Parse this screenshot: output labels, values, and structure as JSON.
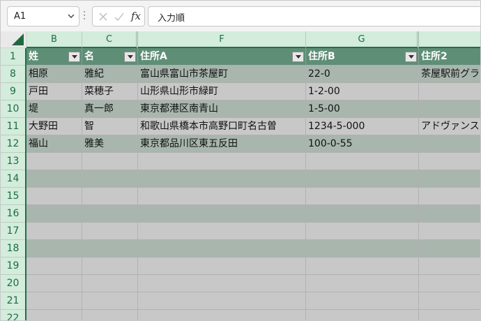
{
  "formula_bar": {
    "name_box": "A1",
    "formula_text": "入力順"
  },
  "columns": [
    "B",
    "C",
    "F",
    "G",
    ""
  ],
  "rows": [
    "1",
    "8",
    "9",
    "10",
    "11",
    "12",
    "13",
    "14",
    "15",
    "16",
    "17",
    "18",
    "19",
    "20",
    "21",
    "22"
  ],
  "table": {
    "headers": [
      "姓",
      "名",
      "住所A",
      "住所B",
      "住所2"
    ],
    "data": [
      [
        "相原",
        "雅紀",
        "富山県富山市茶屋町",
        "22-0",
        "茶屋駅前グラ"
      ],
      [
        "戸田",
        "菜穂子",
        "山形県山形市緑町",
        "1-2-00",
        ""
      ],
      [
        "堤",
        "真一郎",
        "東京都港区南青山",
        "1-5-00",
        ""
      ],
      [
        "大野田",
        "智",
        "和歌山県橋本市高野口町名古曽",
        "1234-5-000",
        "アドヴァンス"
      ],
      [
        "福山",
        "雅美",
        "東京都品川区東五反田",
        "100-0-55",
        ""
      ]
    ]
  },
  "colors": {
    "header_band": "#5f8e77",
    "band_dark": "#a8b6ae",
    "band_light": "#c8c8c8",
    "accent": "#1e7145"
  }
}
